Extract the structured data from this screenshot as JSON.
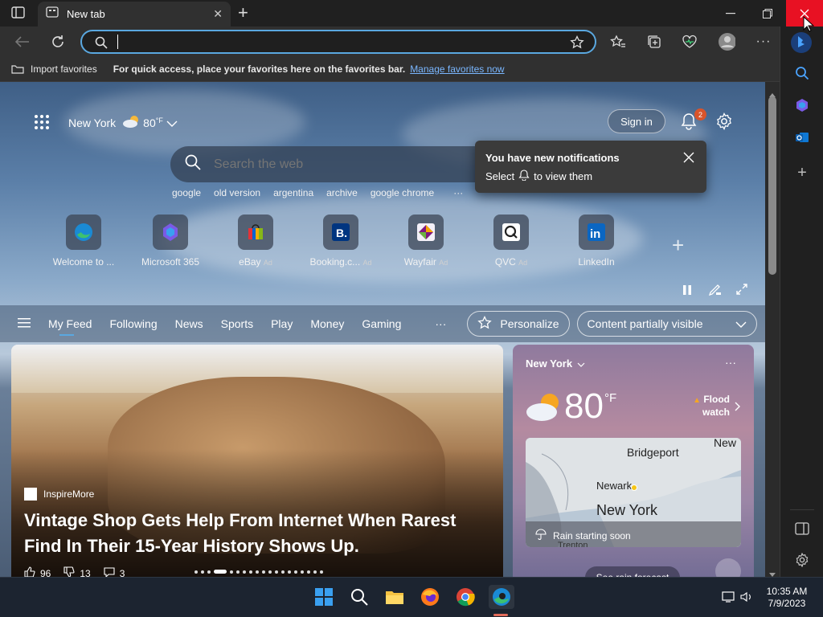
{
  "tab": {
    "title": "New tab"
  },
  "address": {
    "value": "",
    "placeholder": ""
  },
  "favorites": {
    "import_label": "Import favorites",
    "message": "For quick access, place your favorites here on the favorites bar.",
    "manage_link": "Manage favorites now"
  },
  "header": {
    "location": "New York",
    "temp": "80",
    "unit": "°F",
    "sign_in": "Sign in",
    "notif_count": "2"
  },
  "notification_popup": {
    "title": "You have new notifications",
    "body_prefix": "Select",
    "body_suffix": "to view them"
  },
  "search": {
    "placeholder": "Search the web",
    "suggestions": [
      "google",
      "old version",
      "argentina",
      "archive",
      "google chrome"
    ]
  },
  "quick_links": [
    {
      "label": "Welcome to ...",
      "ad": ""
    },
    {
      "label": "Microsoft 365",
      "ad": ""
    },
    {
      "label": "eBay",
      "ad": "Ad"
    },
    {
      "label": "Booking.c...",
      "ad": "Ad"
    },
    {
      "label": "Wayfair",
      "ad": "Ad"
    },
    {
      "label": "QVC",
      "ad": "Ad"
    },
    {
      "label": "LinkedIn",
      "ad": ""
    }
  ],
  "feed_nav": {
    "items": [
      "My Feed",
      "Following",
      "News",
      "Sports",
      "Play",
      "Money",
      "Gaming"
    ],
    "personalize": "Personalize",
    "content_select": "Content partially visible"
  },
  "hero": {
    "source": "InspireMore",
    "headline": "Vintage Shop Gets Help From Internet When Rarest Find In Their 15-Year History Shows Up.",
    "likes": "96",
    "dislikes": "13",
    "comments": "3"
  },
  "weather_card": {
    "location": "New York",
    "temp": "80",
    "unit": "°F",
    "alert": "Flood watch",
    "map_labels": [
      "Bridgeport",
      "New",
      "Newark",
      "New York",
      "Trenton"
    ],
    "rain_text": "Rain starting soon",
    "forecast_button": "See rain forecast"
  },
  "taskbar": {
    "time": "10:35 AM",
    "date": "7/9/2023"
  },
  "colors": {
    "accent": "#5aa8e0",
    "link": "#7ab7ff",
    "close_red": "#e81123",
    "badge": "#d9542b"
  }
}
